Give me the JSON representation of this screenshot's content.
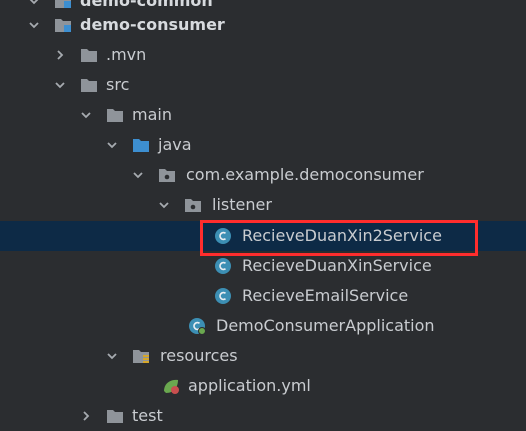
{
  "tree": {
    "items": [
      {
        "label": "demo-common"
      },
      {
        "label": "demo-consumer"
      },
      {
        "label": ".mvn"
      },
      {
        "label": "src"
      },
      {
        "label": "main"
      },
      {
        "label": "java"
      },
      {
        "label": "com.example.democonsumer"
      },
      {
        "label": "listener"
      },
      {
        "label": "RecieveDuanXin2Service"
      },
      {
        "label": "RecieveDuanXinService"
      },
      {
        "label": "RecieveEmailService"
      },
      {
        "label": "DemoConsumerApplication"
      },
      {
        "label": "resources"
      },
      {
        "label": "application.yml"
      },
      {
        "label": "test"
      }
    ]
  },
  "colors": {
    "background": "#2b2d30",
    "selection": "#0d2a46",
    "highlight_box": "#ff2d2d",
    "folder_gray": "#8f949a",
    "folder_blue": "#3d8fd1",
    "class_circle": "#3c8fb4"
  }
}
